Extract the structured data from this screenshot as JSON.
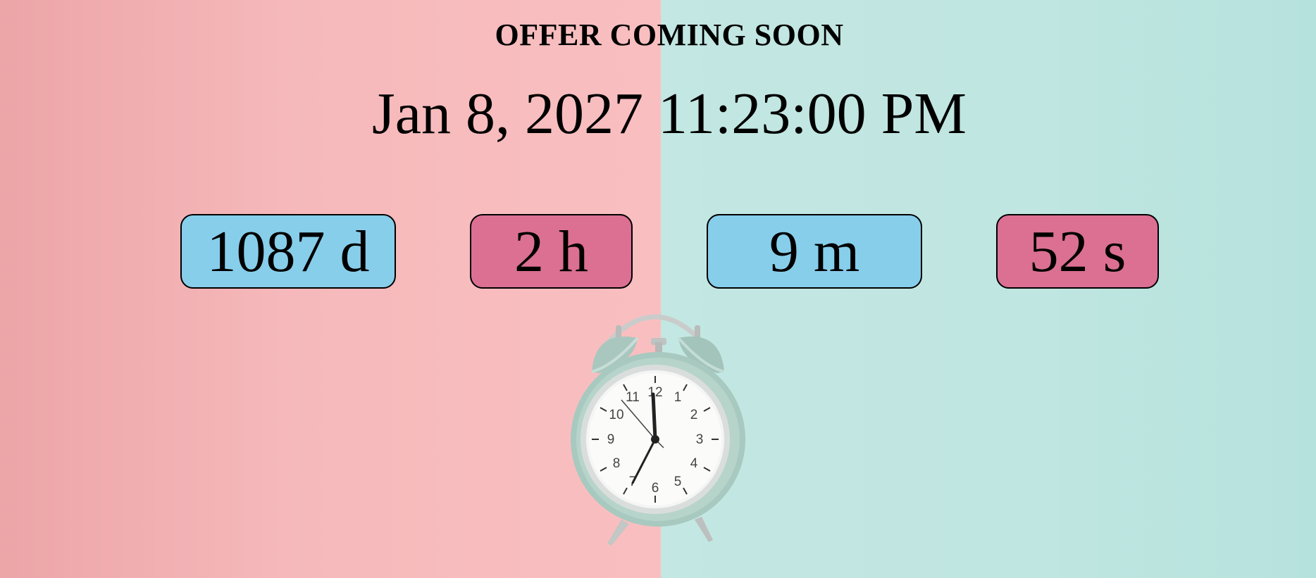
{
  "offer": {
    "headline": "OFFER COMING SOON",
    "target_date": "Jan 8, 2027 11:23:00 PM"
  },
  "countdown": [
    {
      "id": "days",
      "text": "1087 d",
      "value": 1087,
      "unit": "d",
      "color": "#87ceeb"
    },
    {
      "id": "hours",
      "text": "2 h",
      "value": 2,
      "unit": "h",
      "color": "#db7093"
    },
    {
      "id": "minutes",
      "text": "9 m",
      "value": 9,
      "unit": "m",
      "color": "#87ceeb"
    },
    {
      "id": "seconds",
      "text": "52 s",
      "value": 52,
      "unit": "s",
      "color": "#db7093"
    }
  ],
  "colors": {
    "background_left": "#f6b9bb",
    "background_right": "#c0e6e1",
    "box_blue": "#87ceeb",
    "box_pink": "#db7093",
    "text": "#000000"
  },
  "clock_face": {
    "numerals": [
      "12",
      "1",
      "2",
      "3",
      "4",
      "5",
      "6",
      "7",
      "8",
      "9",
      "10",
      "11"
    ]
  }
}
